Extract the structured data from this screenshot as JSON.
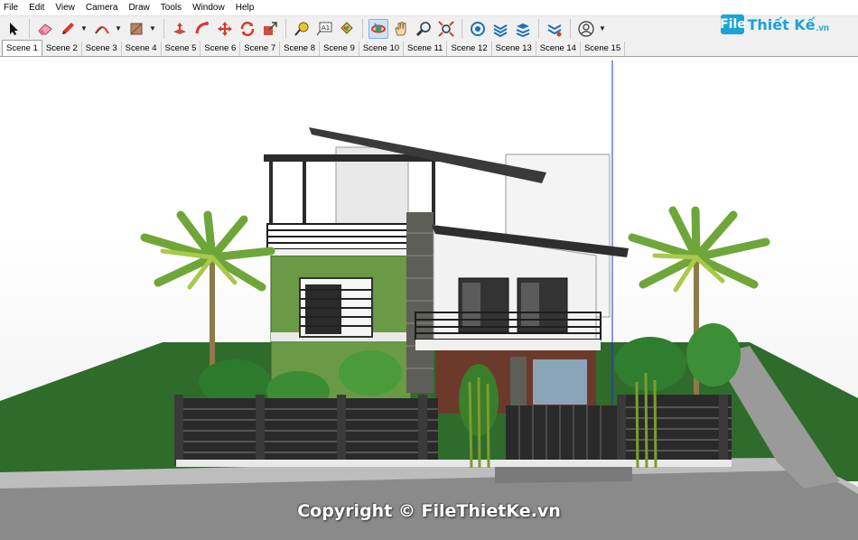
{
  "menu": [
    "File",
    "Edit",
    "View",
    "Camera",
    "Draw",
    "Tools",
    "Window",
    "Help"
  ],
  "toolbar": {
    "tools": [
      {
        "name": "select-tool",
        "icon": "arrow-cursor-icon"
      },
      {
        "name": "eraser-tool",
        "icon": "eraser-icon"
      },
      {
        "name": "pencil-tool",
        "icon": "pencil-icon"
      },
      {
        "name": "arc-tool",
        "icon": "arc-icon"
      },
      {
        "name": "shape-tool",
        "icon": "rectangle-icon"
      },
      {
        "name": "push-pull-tool",
        "icon": "push-pull-icon"
      },
      {
        "name": "follow-me-tool",
        "icon": "follow-me-icon"
      },
      {
        "name": "move-tool",
        "icon": "move-icon"
      },
      {
        "name": "rotate-tool",
        "icon": "rotate-icon"
      },
      {
        "name": "scale-tool",
        "icon": "scale-icon"
      },
      {
        "name": "tape-measure-tool",
        "icon": "tape-measure-icon"
      },
      {
        "name": "text-tool",
        "icon": "text-icon"
      },
      {
        "name": "paint-bucket-tool",
        "icon": "paint-bucket-icon"
      },
      {
        "name": "orbit-tool",
        "icon": "orbit-icon"
      },
      {
        "name": "pan-tool",
        "icon": "hand-icon"
      },
      {
        "name": "zoom-tool",
        "icon": "zoom-icon"
      },
      {
        "name": "zoom-extents-tool",
        "icon": "zoom-extents-icon"
      },
      {
        "name": "warehouse-tool",
        "icon": "warehouse-icon"
      },
      {
        "name": "extension-tool",
        "icon": "extension-icon"
      },
      {
        "name": "layer-tool",
        "icon": "layers-icon"
      },
      {
        "name": "extension-manager-tool",
        "icon": "extension-manager-icon"
      },
      {
        "name": "account-tool",
        "icon": "user-icon"
      }
    ],
    "text_tool_label": "A1"
  },
  "logo": {
    "mark": "File",
    "text": "Thiết Kế",
    "sub": ".vn"
  },
  "scenes": [
    "Scene 1",
    "Scene 2",
    "Scene 3",
    "Scene 4",
    "Scene 5",
    "Scene 6",
    "Scene 7",
    "Scene 8",
    "Scene 9",
    "Scene 10",
    "Scene 11",
    "Scene 12",
    "Scene 13",
    "Scene 14",
    "Scene 15"
  ],
  "active_scene": "Scene 1",
  "viewport": {
    "copyright": "Copyright © FileThietKe.vn"
  },
  "colors": {
    "accent": "#1aa3d6",
    "wall_green": "#6a9a45",
    "wall_white": "#f2f2f2",
    "lawn": "#2f6b2b",
    "road": "#8e8e8e",
    "fence": "#2a2a2a",
    "stone": "#5e5e58"
  }
}
